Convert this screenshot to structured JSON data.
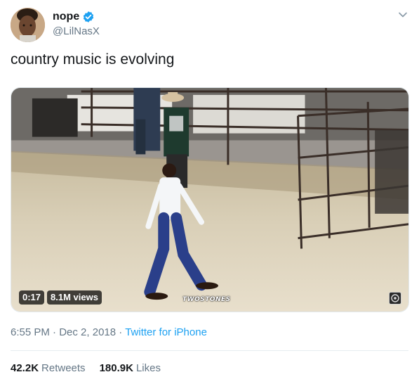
{
  "author": {
    "display_name": "nope",
    "handle": "@LilNasX",
    "verified": true
  },
  "tweet": {
    "text": "country music is evolving"
  },
  "video": {
    "duration": "0:17",
    "views": "8.1M views",
    "watermark": "TWOSTONES"
  },
  "meta": {
    "time": "6:55 PM",
    "separator1": "·",
    "date": "Dec 2, 2018",
    "separator2": "·",
    "source": "Twitter for iPhone"
  },
  "stats": {
    "retweets_count": "42.2K",
    "retweets_label": "Retweets",
    "likes_count": "180.9K",
    "likes_label": "Likes"
  },
  "colors": {
    "link": "#1da1f2",
    "secondary_text": "#657786",
    "primary_text": "#14171a",
    "verified_badge": "#1da1f2"
  },
  "icons": {
    "verified": "verified-badge-icon",
    "menu": "chevron-down-icon"
  }
}
